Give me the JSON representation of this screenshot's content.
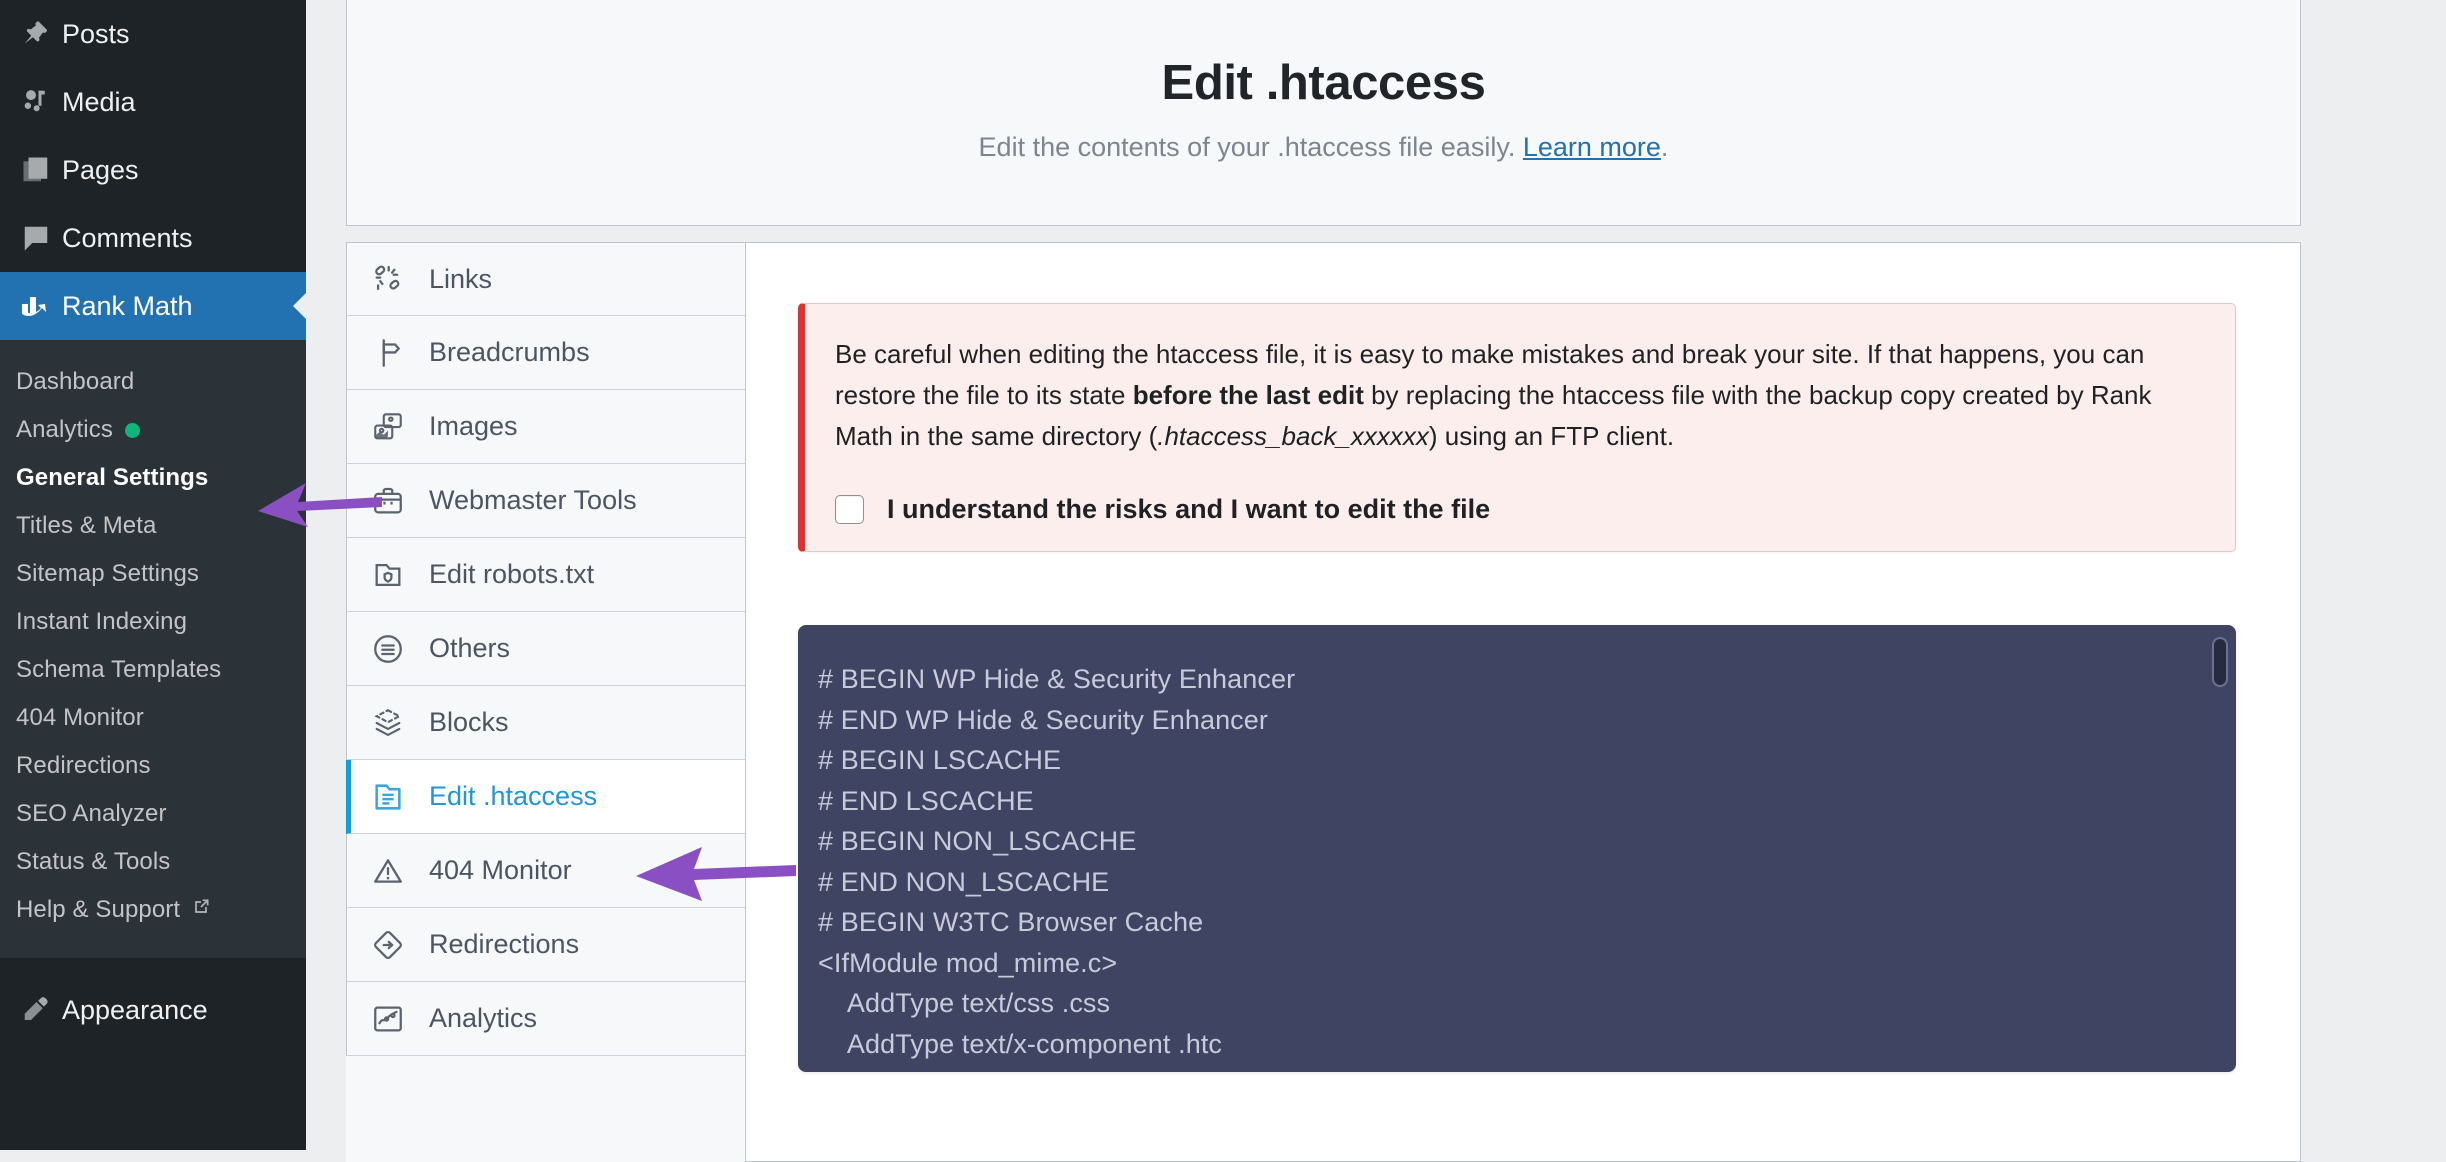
{
  "wp_sidebar": {
    "top_items": [
      {
        "label": "Posts",
        "icon": "pin-icon"
      },
      {
        "label": "Media",
        "icon": "media-icon"
      },
      {
        "label": "Pages",
        "icon": "pages-icon"
      },
      {
        "label": "Comments",
        "icon": "comment-icon"
      }
    ],
    "current_item": {
      "label": "Rank Math",
      "icon": "rank-math-icon"
    },
    "submenu": [
      {
        "label": "Dashboard",
        "current": false,
        "badge": "",
        "external": false
      },
      {
        "label": "Analytics",
        "current": false,
        "badge": "green-dot",
        "external": false
      },
      {
        "label": "General Settings",
        "current": true,
        "badge": "",
        "external": false
      },
      {
        "label": "Titles & Meta",
        "current": false,
        "badge": "",
        "external": false
      },
      {
        "label": "Sitemap Settings",
        "current": false,
        "badge": "",
        "external": false
      },
      {
        "label": "Instant Indexing",
        "current": false,
        "badge": "",
        "external": false
      },
      {
        "label": "Schema Templates",
        "current": false,
        "badge": "",
        "external": false
      },
      {
        "label": "404 Monitor",
        "current": false,
        "badge": "",
        "external": false
      },
      {
        "label": "Redirections",
        "current": false,
        "badge": "",
        "external": false
      },
      {
        "label": "SEO Analyzer",
        "current": false,
        "badge": "",
        "external": false
      },
      {
        "label": "Status & Tools",
        "current": false,
        "badge": "",
        "external": false
      },
      {
        "label": "Help & Support",
        "current": false,
        "badge": "",
        "external": true
      }
    ],
    "bottom_items": [
      {
        "label": "Appearance",
        "icon": "brush-icon"
      }
    ]
  },
  "header": {
    "title": "Edit .htaccess",
    "description_before": "Edit the contents of your .htaccess file easily.",
    "learn_more_label": "Learn more",
    "description_after": "."
  },
  "tabs": [
    {
      "label": "Links",
      "icon": "links-icon",
      "active": false
    },
    {
      "label": "Breadcrumbs",
      "icon": "signpost-icon",
      "active": false
    },
    {
      "label": "Images",
      "icon": "images-icon",
      "active": false
    },
    {
      "label": "Webmaster Tools",
      "icon": "briefcase-icon",
      "active": false
    },
    {
      "label": "Edit robots.txt",
      "icon": "folder-shield-icon",
      "active": false
    },
    {
      "label": "Others",
      "icon": "list-circle-icon",
      "active": false
    },
    {
      "label": "Blocks",
      "icon": "layers-icon",
      "active": false
    },
    {
      "label": "Edit .htaccess",
      "icon": "file-lines-icon",
      "active": true
    },
    {
      "label": "404 Monitor",
      "icon": "warning-triangle-icon",
      "active": false
    },
    {
      "label": "Redirections",
      "icon": "diamond-arrow-icon",
      "active": false
    },
    {
      "label": "Analytics",
      "icon": "analytics-chart-icon",
      "active": false
    }
  ],
  "notice": {
    "part1": "Be careful when editing the htaccess file, it is easy to make mistakes and break your site. If that happens, you can restore the file to its state ",
    "bold": "before the last edit",
    "part2": " by replacing the htaccess file with the backup copy created by Rank Math in the same directory (",
    "italic": ".htaccess_back_xxxxxx",
    "part3": ") using an FTP client.",
    "checkbox_label": "I understand the risks and I want to edit the file",
    "checkbox_checked": false,
    "accent_color": "#dc3232",
    "background_color": "#fdeeee"
  },
  "editor": {
    "content": "# BEGIN WP Hide & Security Enhancer\n# END WP Hide & Security Enhancer\n# BEGIN LSCACHE\n# END LSCACHE\n# BEGIN NON_LSCACHE\n# END NON_LSCACHE\n# BEGIN W3TC Browser Cache\n<IfModule mod_mime.c>\n    AddType text/css .css\n    AddType text/x-component .htc\n    AddType application/x-javascript .js",
    "background_color": "#3f4463",
    "text_color": "#c8cbd9"
  },
  "annotations": {
    "arrow_color": "#8b4fc4",
    "arrows": [
      {
        "name": "arrow-pointing-general-settings",
        "target": "General Settings"
      },
      {
        "name": "arrow-pointing-edit-htaccess",
        "target": "Edit .htaccess"
      }
    ]
  },
  "theme": {
    "wp_sidebar_bg": "#1d2327",
    "wp_submenu_bg": "#2c3338",
    "wp_active_blue": "#2271b1",
    "page_bg": "#eceef0",
    "active_tab_blue": "#0f9fdb"
  }
}
